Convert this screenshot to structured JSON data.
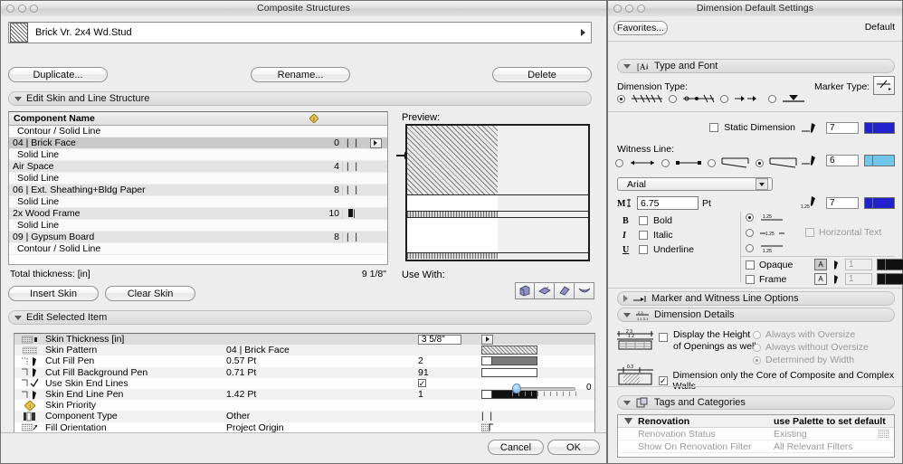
{
  "left_window": {
    "title": "Composite Structures",
    "name_field": {
      "value": "Brick Vr. 2x4 Wd.Stud",
      "icon": "composite-swatch-icon"
    },
    "buttons": {
      "duplicate": "Duplicate...",
      "rename": "Rename...",
      "delete": "Delete"
    },
    "skin_section": {
      "label": "Edit Skin and Line Structure"
    },
    "list": {
      "headers": {
        "name": "Component Name",
        "priority": "priority-icon",
        "bar": "",
        "pop": ""
      },
      "rows": [
        {
          "type": "line",
          "name": "Contour /  Solid Line",
          "num": "",
          "mark": "dash",
          "pop": false
        },
        {
          "type": "skin",
          "name": "04 | Brick Face",
          "num": "0",
          "mark": "bars",
          "pop": true,
          "selected": true
        },
        {
          "type": "line",
          "name": "Solid Line",
          "num": "",
          "mark": "dash",
          "pop": false
        },
        {
          "type": "skin",
          "name": "Air Space",
          "num": "4",
          "mark": "bars",
          "pop": false
        },
        {
          "type": "line",
          "name": "Solid Line",
          "num": "",
          "mark": "dash",
          "pop": false
        },
        {
          "type": "skin",
          "name": "06 | Ext. Sheathing+Bldg Paper",
          "num": "8",
          "mark": "bars",
          "pop": false
        },
        {
          "type": "line",
          "name": "Solid Line",
          "num": "",
          "mark": "dash",
          "pop": false
        },
        {
          "type": "skin",
          "name": "2x Wood Frame",
          "num": "10",
          "mark": "block",
          "pop": false
        },
        {
          "type": "line",
          "name": "Solid Line",
          "num": "",
          "mark": "dash",
          "pop": false
        },
        {
          "type": "skin",
          "name": "09 | Gypsum Board",
          "num": "8",
          "mark": "bars",
          "pop": false
        },
        {
          "type": "line",
          "name": "Contour /  Solid Line",
          "num": "",
          "mark": "dash",
          "pop": false
        }
      ],
      "total_label": "Total thickness: [in]",
      "total_value": "9 1/8\""
    },
    "skin_buttons": {
      "insert": "Insert Skin",
      "clear": "Clear Skin"
    },
    "preview": {
      "label": "Preview:",
      "use_with_label": "Use With:"
    },
    "use_with_icons": [
      "wall-icon",
      "slab-icon",
      "roof-icon",
      "shell-icon"
    ],
    "edit_item_section": {
      "label": "Edit Selected Item"
    },
    "edit_rows": [
      {
        "icon": "skin-thickness-icon",
        "label": "Skin Thickness [in]",
        "value": "",
        "num": "",
        "field": "3 5/8\"",
        "swatch": "popup",
        "header": true
      },
      {
        "icon": "skin-pattern-icon",
        "label": "Skin Pattern",
        "value": "04 | Brick Face",
        "num": "",
        "swatch": "hatch"
      },
      {
        "icon": "cut-fill-pen-icon",
        "label": "Cut Fill Pen",
        "value": "0.57 Pt",
        "num": "2",
        "swatch": "pen-dark"
      },
      {
        "icon": "cut-fill-bg-pen-icon",
        "label": "Cut Fill Background Pen",
        "value": "0.71 Pt",
        "num": "91",
        "swatch": "pen-white"
      },
      {
        "icon": "use-skin-end-lines-icon",
        "label": "Use Skin End Lines",
        "value": "",
        "num": "check",
        "swatch": "none"
      },
      {
        "icon": "skin-end-line-pen-icon",
        "label": "Skin End Line Pen",
        "value": "1.42 Pt",
        "num": "1",
        "swatch": "pen-black"
      },
      {
        "icon": "skin-priority-icon",
        "label": "Skin Priority",
        "value": "",
        "num": "",
        "swatch": "slider",
        "slider_value": "0"
      },
      {
        "icon": "component-type-icon",
        "label": "Component Type",
        "value": "Other",
        "num": "",
        "swatch": "bars"
      },
      {
        "icon": "fill-orientation-icon",
        "label": "Fill Orientation",
        "value": "Project Origin",
        "num": "",
        "swatch": "orient"
      }
    ],
    "footer": {
      "cancel": "Cancel",
      "ok": "OK"
    }
  },
  "right_window": {
    "title": "Dimension Default Settings",
    "favorites_button": "Favorites...",
    "default_label": "Default",
    "sections": {
      "type_and_font": "Type and Font",
      "marker_witness": "Marker and Witness Line Options",
      "dimension_details": "Dimension Details",
      "tags_categories": "Tags and Categories"
    },
    "dimension_type": {
      "label": "Dimension Type:",
      "options": [
        "linear-ticks-icon",
        "linear-dots-icon",
        "arrows-icon",
        "level-icon"
      ],
      "selected_index": 0
    },
    "marker_type": {
      "label": "Marker Type:",
      "icon": "marker-slash-icon"
    },
    "static_dimension": {
      "label": "Static Dimension",
      "checked": false,
      "pen_value": "7",
      "pen_color": "#2222cc"
    },
    "witness_line": {
      "label": "Witness Line:",
      "options": [
        "witness-line-plain-icon",
        "witness-line-dot-icon",
        "witness-line-bracket-icon",
        "witness-line-bracket2-icon"
      ],
      "selected_index": 3,
      "pen_value": "6",
      "pen_color": "#6fc6ea"
    },
    "font": {
      "family": "Arial",
      "size": "6.75",
      "size_unit": "Pt",
      "pen_value": "7",
      "pen_color": "#2222cc",
      "styles": [
        {
          "glyph": "B",
          "label": "Bold",
          "checked": false
        },
        {
          "glyph": "I",
          "label": "Italic",
          "checked": false
        },
        {
          "glyph": "U",
          "label": "Underline",
          "checked": false
        }
      ],
      "placement_options": [
        "text-above-line-icon",
        "text-on-line-icon",
        "text-below-line-icon"
      ],
      "placement_selected": 0,
      "horizontal_text": {
        "label": "Horizontal Text",
        "checked": false,
        "disabled": true
      },
      "opaque": {
        "label": "Opaque",
        "checked": false,
        "value": "1"
      },
      "frame": {
        "label": "Frame",
        "checked": false,
        "value": "1"
      }
    },
    "dimension_details": {
      "display_height": {
        "label_line1": "Display the Height",
        "label_line2": "of Openings as well",
        "checked": false
      },
      "oversize_options": [
        {
          "label": "Always with Oversize",
          "selected": false
        },
        {
          "label": "Always without Oversize",
          "selected": false
        },
        {
          "label": "Determined by Width",
          "selected": true
        }
      ],
      "core_only": {
        "label": "Dimension only the Core of Composite and Complex Walls",
        "checked": true
      }
    },
    "tags_table": {
      "headers": {
        "col1": "Renovation",
        "col2": "use Palette to set default"
      },
      "rows": [
        {
          "name": "Renovation Status",
          "value": "Existing",
          "icon": "hatch-icon"
        },
        {
          "name": "Show On Renovation Filter",
          "value": "All Relevant Filters",
          "icon": ""
        }
      ]
    }
  }
}
